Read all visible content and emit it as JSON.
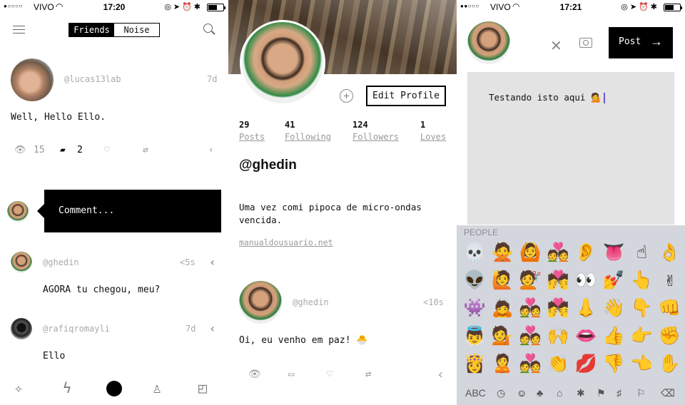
{
  "status": {
    "carrier": "VIVO",
    "time_left": "17:20",
    "time_right": "17:21"
  },
  "feed": {
    "tabs": [
      "Friends",
      "Noise"
    ],
    "active_tab": "Friends",
    "post": {
      "username": "@lucas13lab",
      "age": "7d",
      "text": "Well, Hello Ello.",
      "views": "15",
      "comments": "2"
    },
    "comment_placeholder": "Comment...",
    "comments": [
      {
        "username": "@ghedin",
        "age": "<5s",
        "text": "AGORA tu chegou, meu?"
      },
      {
        "username": "@rafiqromayli",
        "age": "7d",
        "text": "Ello"
      }
    ]
  },
  "profile": {
    "edit_label": "Edit Profile",
    "stats": [
      {
        "value": "29",
        "label": "Posts"
      },
      {
        "value": "41",
        "label": "Following"
      },
      {
        "value": "124",
        "label": "Followers"
      },
      {
        "value": "1",
        "label": "Loves"
      }
    ],
    "username": "@ghedin",
    "bio": "Uma vez comi pipoca de micro-ondas vencida.",
    "link": "manualdousuario.net",
    "post": {
      "username": "@ghedin",
      "age": "<10s",
      "text": "Oi, eu venho em paz! 🐣"
    }
  },
  "composer": {
    "post_label": "Post",
    "text": "Testando isto aqui 💁"
  },
  "keyboard": {
    "category": "PEOPLE",
    "abc_label": "ABC",
    "emojis": [
      "💀",
      "🙅",
      "🙆",
      "💑",
      "👂",
      "👅",
      "☝",
      "👌",
      "👽",
      "🙋",
      "💇",
      "💏",
      "👀",
      "💅",
      "👆",
      "✌",
      "👾",
      "🙇",
      "💑",
      "💏",
      "👃",
      "👋",
      "👇",
      "👊",
      "👼",
      "💁",
      "💑",
      "🙌",
      "👄",
      "👍",
      "👉",
      "✊",
      "👸",
      "🙎",
      "💑",
      "👏",
      "💋",
      "👎",
      "👈",
      "✋"
    ]
  }
}
